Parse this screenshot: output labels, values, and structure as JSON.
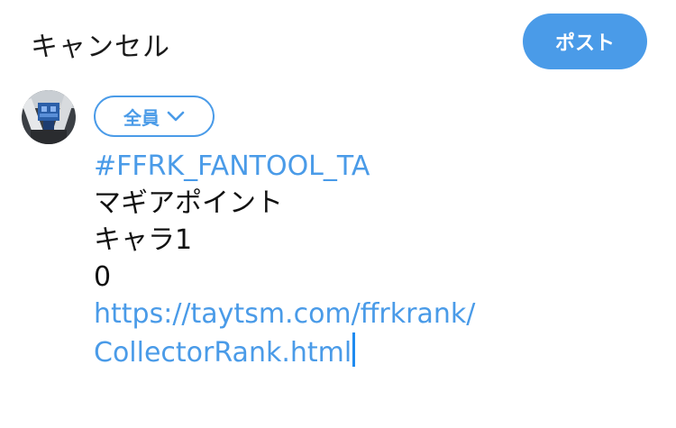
{
  "header": {
    "cancel_label": "キャンセル",
    "post_label": "ポスト"
  },
  "audience": {
    "label": "全員",
    "icon": "chevron-down-icon"
  },
  "avatar": {
    "icon": "user-avatar"
  },
  "compose": {
    "hashtag": "#FFRK_FANTOOL_TA",
    "line2": "マギアポイント",
    "line3": "キャラ1",
    "line4": "0",
    "url_part1": "https://taytsm.com/ffrkrank/",
    "url_part2": "CollectorRank.html"
  },
  "colors": {
    "accent": "#4a9be8",
    "text": "#111111",
    "background": "#ffffff"
  }
}
